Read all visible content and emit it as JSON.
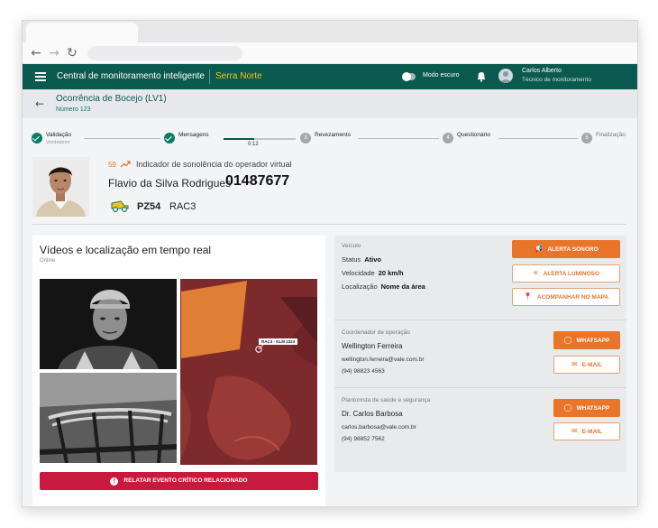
{
  "browser": {
    "back_glyph": "←",
    "forward_glyph": "→",
    "reload_glyph": "↻"
  },
  "appbar": {
    "title": "Central de monitoramento inteligente",
    "site": "Serra Norte",
    "dark_mode_label": "Modo escuro",
    "user_name": "Carlos Alberto",
    "user_role": "Técnico de monitoramento",
    "colors": {
      "bar": "#0b5a4f",
      "site": "#f3c416"
    }
  },
  "occurrence": {
    "back_glyph": "←",
    "title": "Ocorrência de Bocejo (LV1)",
    "number": "Número 123"
  },
  "stepper": {
    "steps": [
      {
        "label": "Validação",
        "sub": "Verdadeiro",
        "state": "done",
        "index": ""
      },
      {
        "label": "Mensagens",
        "sub": "",
        "state": "done",
        "index": ""
      },
      {
        "label": "Revezamento",
        "sub": "",
        "state": "todo",
        "index": "3"
      },
      {
        "label": "Questionário",
        "sub": "",
        "state": "todo",
        "index": "4"
      },
      {
        "label": "Finalização",
        "sub": "",
        "state": "todo",
        "index": "5"
      }
    ],
    "progress_time": "0:12",
    "progress_fraction": 0.42
  },
  "operator": {
    "score": "59",
    "indicator": "Indicador de sonolência do operador virtual",
    "name": "Flavio da Silva Rodrigues",
    "id": "01487677",
    "equipment_code": "PZ54",
    "equipment_model": "RAC3"
  },
  "video": {
    "title": "Vídeos e localização em tempo real",
    "status": "Online",
    "map_label": "RAC3 - KLM 2323",
    "critical_button": "RELATAR EVENTO CRÍTICO RELACIONADO"
  },
  "vehicle": {
    "section": "Veículo",
    "status_label": "Status",
    "status_value": "Ativo",
    "speed_label": "Velocidade",
    "speed_value": "20 km/h",
    "location_label": "Localização",
    "location_value": "Nome da área",
    "alert_sound": "ALERTA SONORO",
    "alert_light": "ALERTA LUMINOSO",
    "follow_map": "ACOMPANHAR NO MAPA"
  },
  "coordinator": {
    "section": "Coordenador de operação",
    "name": "Wellington Ferreira",
    "email": "wellington.ferreira@vale.com.br",
    "phone": "(94) 98823 4563",
    "whatsapp": "WHATSAPP",
    "email_btn": "E-MAIL"
  },
  "health": {
    "section": "Plantonista de saúde e segurança",
    "name": "Dr. Carlos Barbosa",
    "email": "carlos.barbosa@vale.com.br",
    "phone": "(94) 98852 7562",
    "whatsapp": "WHATSAPP",
    "email_btn": "E-MAIL"
  },
  "colors": {
    "accent": "#e8752a",
    "critical": "#c8193f",
    "success": "#0b7a66"
  }
}
